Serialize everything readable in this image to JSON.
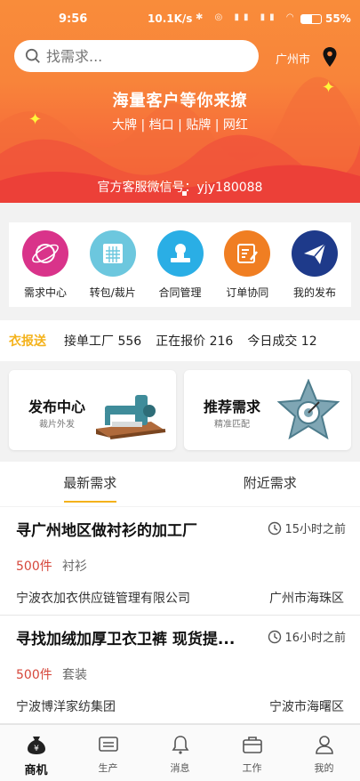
{
  "status_bar": {
    "time": "9:56",
    "speed": "10.1K/s",
    "battery": "55%"
  },
  "header": {
    "search_placeholder": "找需求...",
    "city": "广州市",
    "banner_title": "海量客户等你来撩",
    "banner_sub": "大牌 | 档口 | 贴牌 | 网红",
    "wechat": "官方客服微信号：yjy180088"
  },
  "quick_icons": [
    {
      "label": "需求中心",
      "icon": "planet-icon",
      "color": "#d9338a"
    },
    {
      "label": "转包/裁片",
      "icon": "fabric-icon",
      "color": "#6cc7de"
    },
    {
      "label": "合同管理",
      "icon": "stamp-icon",
      "color": "#2aaee5"
    },
    {
      "label": "订单协同",
      "icon": "edit-icon",
      "color": "#f07e22"
    },
    {
      "label": "我的发布",
      "icon": "paper-plane-icon",
      "color": "#1e3a8a"
    }
  ],
  "stats": {
    "brand": "衣报送",
    "factories": "接单工厂 556",
    "quoting": "正在报价 216",
    "deals": "今日成交 12"
  },
  "cards": [
    {
      "title": "发布中心",
      "sub": "裁片外发",
      "icon": "sewing-machine-icon"
    },
    {
      "title": "推荐需求",
      "sub": "精准匹配",
      "icon": "star-badge-icon"
    }
  ],
  "tabs": [
    {
      "label": "最新需求"
    },
    {
      "label": "附近需求"
    }
  ],
  "items": [
    {
      "title": "寻广州地区做衬衫的加工厂",
      "time": "15小时之前",
      "price": "500件",
      "category": "衬衫",
      "company": "宁波衣加衣供应链管理有限公司",
      "location": "广州市海珠区"
    },
    {
      "title": "寻找加绒加厚卫衣卫裤 现货提...",
      "time": "16小时之前",
      "price": "500件",
      "category": "套装",
      "company": "宁波博洋家纺集团",
      "location": "宁波市海曙区"
    }
  ],
  "bottom_nav": [
    {
      "label": "商机",
      "icon": "money-bag-icon"
    },
    {
      "label": "生产",
      "icon": "printer-icon"
    },
    {
      "label": "消息",
      "icon": "bell-icon"
    },
    {
      "label": "工作",
      "icon": "briefcase-icon"
    },
    {
      "label": "我的",
      "icon": "user-icon"
    }
  ]
}
